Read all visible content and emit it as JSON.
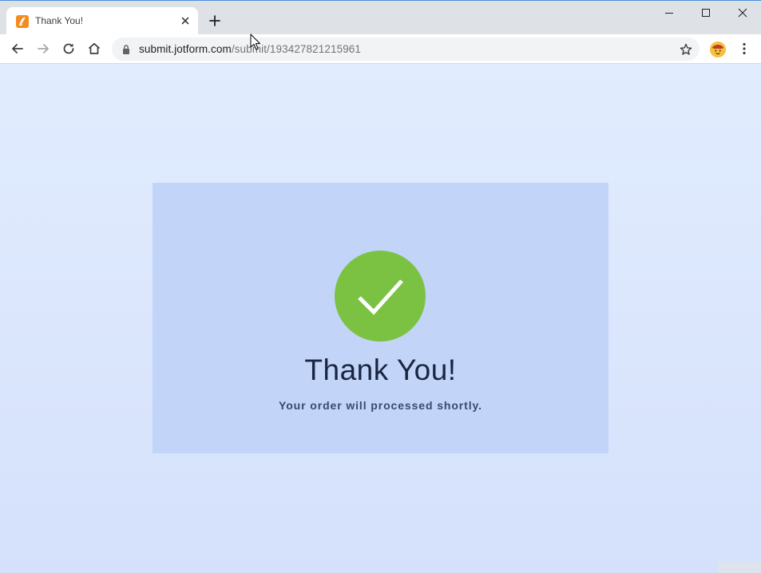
{
  "browser": {
    "tab": {
      "title": "Thank You!"
    },
    "address_bar": {
      "url_host": "submit.jotform.com",
      "url_path": "/submit/193427821215961"
    }
  },
  "page": {
    "heading": "Thank You!",
    "message": "Your order will processed shortly."
  },
  "colors": {
    "page_background": "#dde8fd",
    "card_background": "#c2d4f8",
    "success_circle": "#7cc242",
    "heading_text": "#1a2540",
    "message_text": "#3b4a6b",
    "favicon": "#f58b1f"
  },
  "icons": {
    "tab": [
      "jotform-favicon-icon",
      "close-icon",
      "plus-icon"
    ],
    "window": [
      "minimize-icon",
      "maximize-icon",
      "close-icon"
    ],
    "toolbar": [
      "back-arrow-icon",
      "forward-arrow-icon",
      "reload-icon",
      "home-icon",
      "lock-icon",
      "star-icon",
      "profile-avatar",
      "kebab-menu-icon"
    ],
    "content": [
      "checkmark-icon"
    ]
  }
}
